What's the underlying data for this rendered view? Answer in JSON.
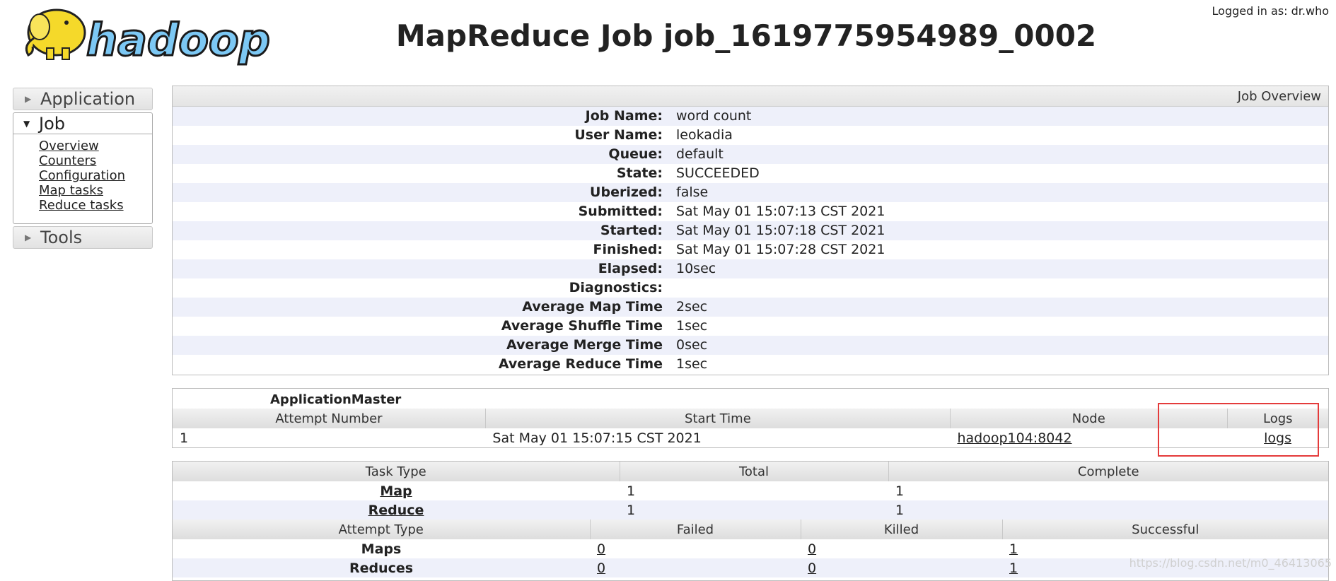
{
  "header": {
    "logo_text": "hadoop",
    "title": "MapReduce Job job_1619775954989_0002",
    "logged_in": "Logged in as: dr.who"
  },
  "sidebar": {
    "application": "Application",
    "job": "Job",
    "job_links": [
      "Overview",
      "Counters",
      "Configuration",
      "Map tasks",
      "Reduce tasks"
    ],
    "tools": "Tools"
  },
  "overview": {
    "heading": "Job Overview",
    "rows": [
      {
        "label": "Job Name:",
        "value": "word count"
      },
      {
        "label": "User Name:",
        "value": "leokadia"
      },
      {
        "label": "Queue:",
        "value": "default"
      },
      {
        "label": "State:",
        "value": "SUCCEEDED"
      },
      {
        "label": "Uberized:",
        "value": "false"
      },
      {
        "label": "Submitted:",
        "value": "Sat May 01 15:07:13 CST 2021"
      },
      {
        "label": "Started:",
        "value": "Sat May 01 15:07:18 CST 2021"
      },
      {
        "label": "Finished:",
        "value": "Sat May 01 15:07:28 CST 2021"
      },
      {
        "label": "Elapsed:",
        "value": "10sec"
      },
      {
        "label": "Diagnostics:",
        "value": ""
      },
      {
        "label": "Average Map Time",
        "value": "2sec"
      },
      {
        "label": "Average Shuffle Time",
        "value": "1sec"
      },
      {
        "label": "Average Merge Time",
        "value": "0sec"
      },
      {
        "label": "Average Reduce Time",
        "value": "1sec"
      }
    ]
  },
  "am": {
    "title": "ApplicationMaster",
    "headers": [
      "Attempt Number",
      "Start Time",
      "Node",
      "Logs"
    ],
    "row": {
      "attempt": "1",
      "start": "Sat May 01 15:07:15 CST 2021",
      "node": "hadoop104:8042",
      "logs": "logs"
    }
  },
  "tasks": {
    "headers": [
      "Task Type",
      "Total",
      "Complete"
    ],
    "rows": [
      {
        "type": "Map",
        "total": "1",
        "complete": "1"
      },
      {
        "type": "Reduce",
        "total": "1",
        "complete": "1"
      }
    ],
    "attempt_headers": [
      "Attempt Type",
      "Failed",
      "Killed",
      "Successful"
    ],
    "attempt_rows": [
      {
        "type": "Maps",
        "failed": "0",
        "killed": "0",
        "successful": "1"
      },
      {
        "type": "Reduces",
        "failed": "0",
        "killed": "0",
        "successful": "1"
      }
    ]
  },
  "watermark": "https://blog.csdn.net/m0_46413065",
  "colors": {
    "highlight_box": "#e43b3b",
    "stripe": "#eef0fa"
  }
}
